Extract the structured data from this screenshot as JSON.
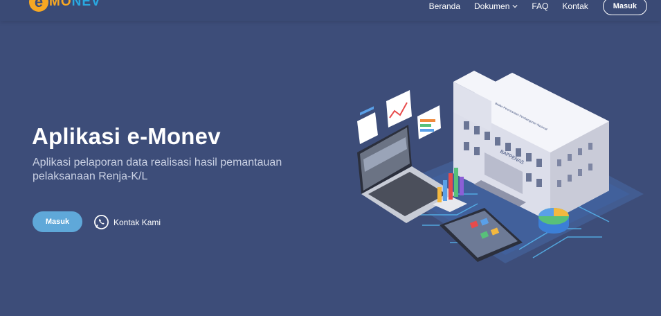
{
  "header": {
    "logo_letter": "e",
    "logo_mo": "MO",
    "logo_nev": "NEV",
    "nav": [
      {
        "label": "Beranda"
      },
      {
        "label": "Dokumen"
      },
      {
        "label": "FAQ"
      },
      {
        "label": "Kontak"
      }
    ],
    "login_label": "Masuk"
  },
  "hero": {
    "title": "Aplikasi e-Monev",
    "subtitle": "Aplikasi pelaporan data realisasi hasil pemantauan pelaksanaan Renja-K/L",
    "primary_button": "Masuk",
    "contact_label": "Kontak Kami"
  },
  "illustration": {
    "building_sign": "BAPPENAS",
    "building_roof_text": "Badan Perencanaan Pembangunan Nasional"
  },
  "colors": {
    "background": "#3d4d79",
    "button_primary": "#5fa8d9",
    "logo_orange": "#f7a823",
    "logo_blue": "#29a8e0"
  }
}
